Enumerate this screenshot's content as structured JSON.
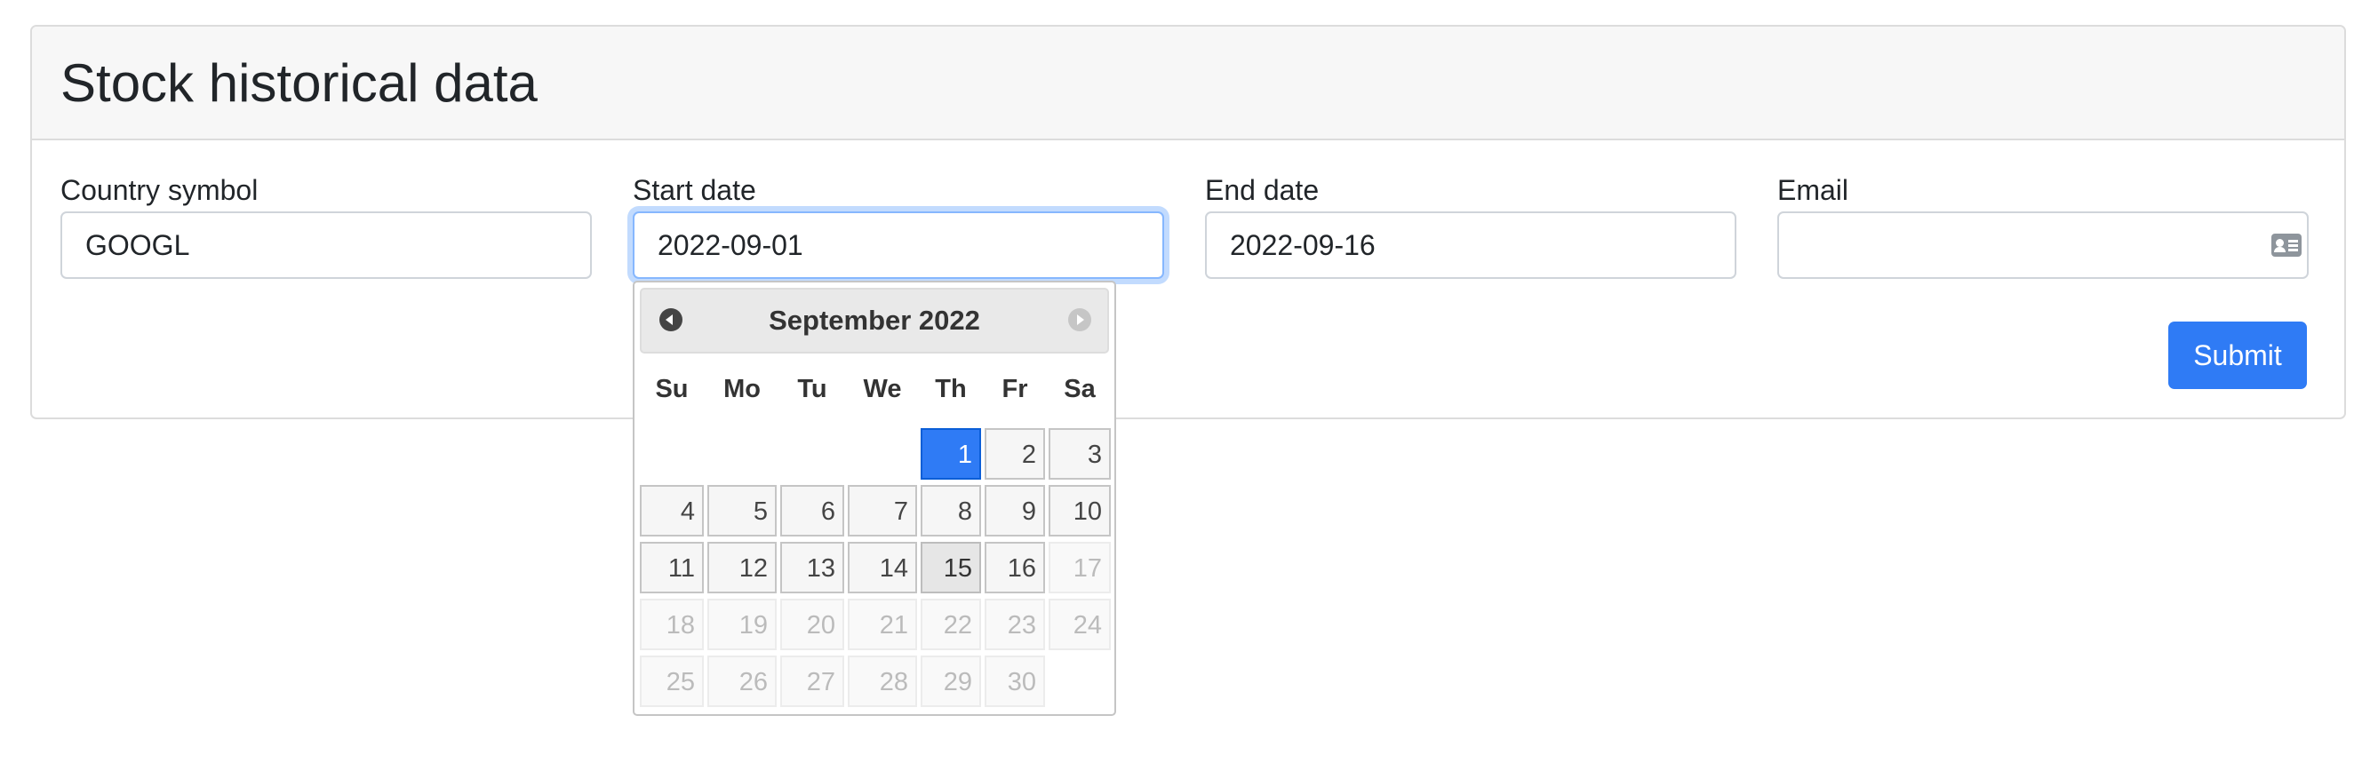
{
  "card": {
    "title": "Stock historical data"
  },
  "form": {
    "country_symbol": {
      "label": "Country symbol",
      "value": "GOOGL"
    },
    "start_date": {
      "label": "Start date",
      "value": "2022-09-01"
    },
    "end_date": {
      "label": "End date",
      "value": "2022-09-16"
    },
    "email": {
      "label": "Email",
      "value": "",
      "icon": "contact-card-icon"
    },
    "submit_label": "Submit"
  },
  "datepicker": {
    "title": "September 2022",
    "weekdays": [
      "Su",
      "Mo",
      "Tu",
      "We",
      "Th",
      "Fr",
      "Sa"
    ],
    "first_weekday_index": 4,
    "days_in_month": 30,
    "selected_day": 1,
    "today_day": 15,
    "max_enabled_day": 16
  },
  "colors": {
    "primary": "#2f7bf5",
    "focus_border": "#86b7fe"
  }
}
